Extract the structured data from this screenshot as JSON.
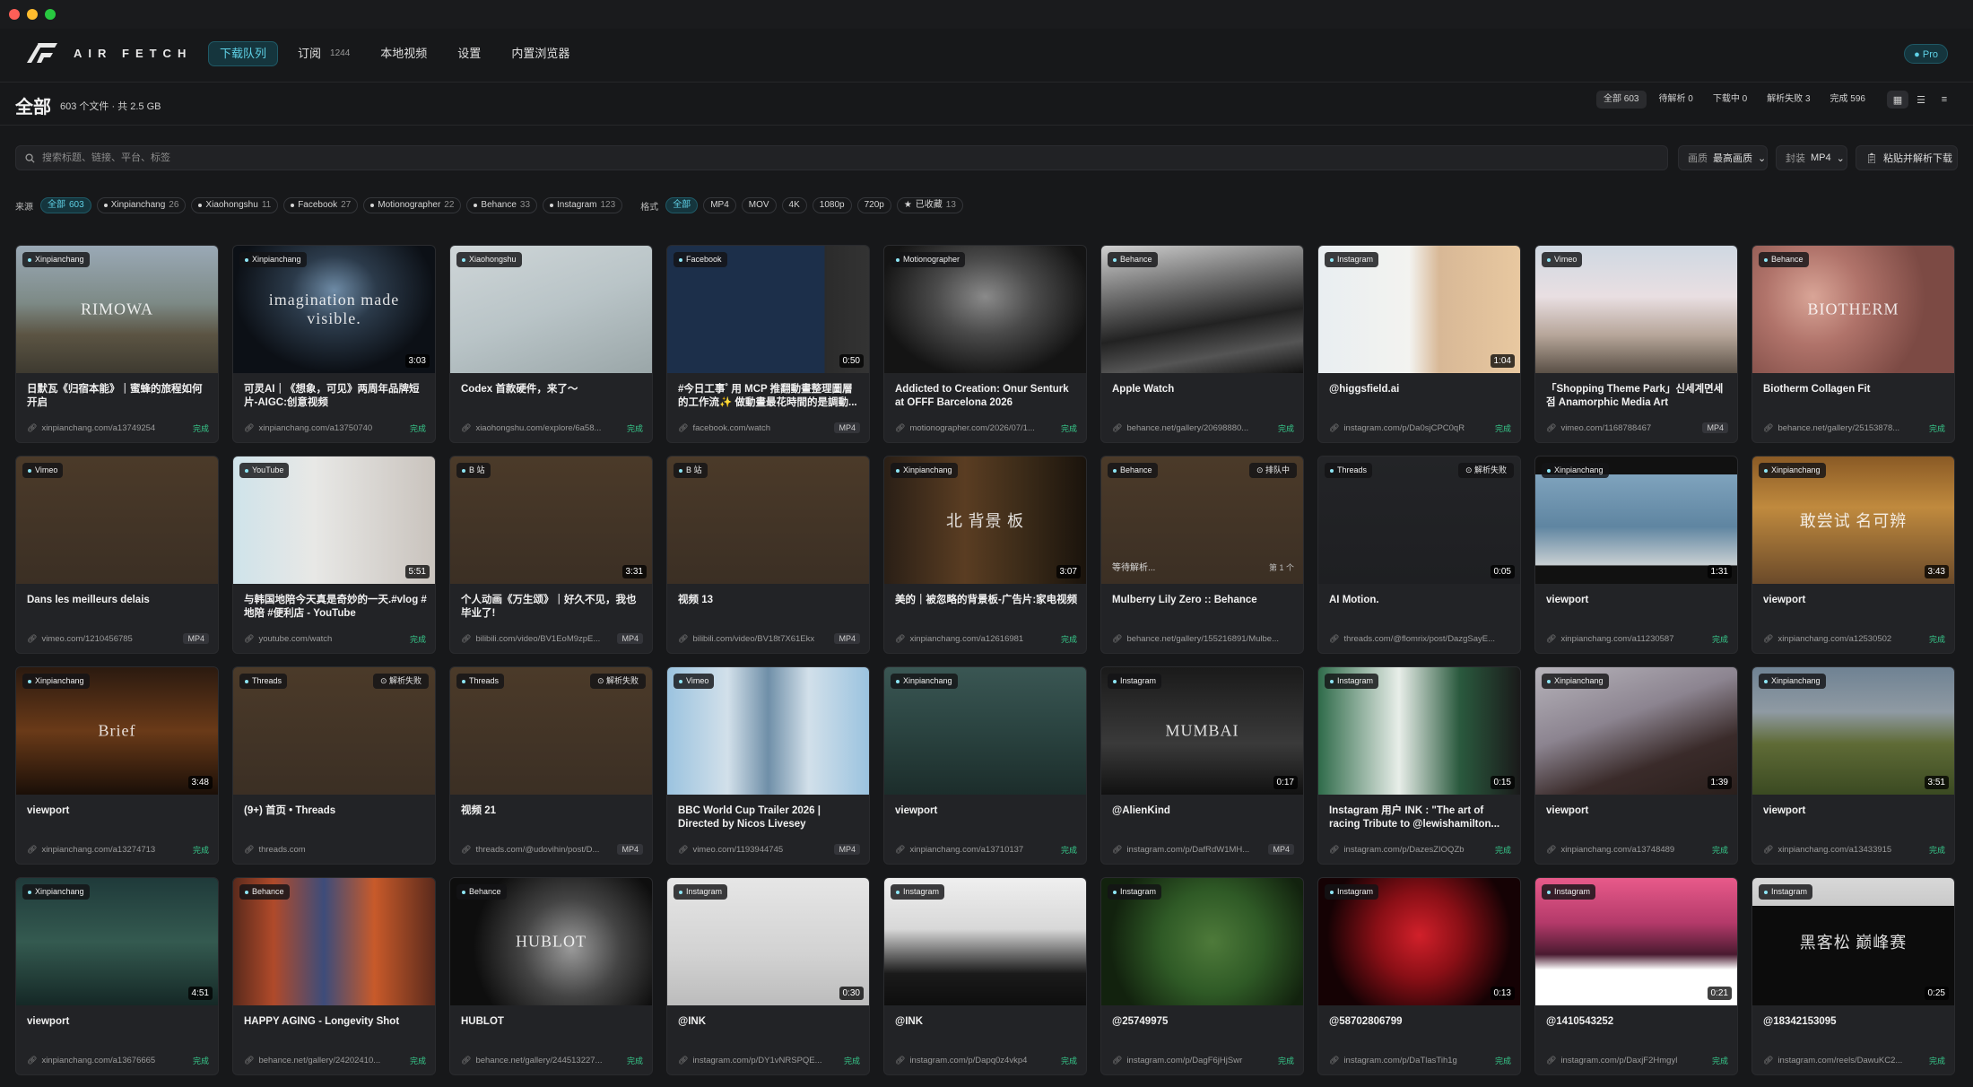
{
  "colors": {
    "accent": "#5fd1e6",
    "done": "#37c98b",
    "bg": "#17181a"
  },
  "app": {
    "brand": "AIR FETCH",
    "pro": "Pro"
  },
  "nav": {
    "tabs": [
      {
        "label": "下载队列",
        "count": ""
      },
      {
        "label": "订阅",
        "count": "1244"
      },
      {
        "label": "本地视频",
        "count": ""
      },
      {
        "label": "设置",
        "count": ""
      },
      {
        "label": "内置浏览器",
        "count": ""
      }
    ]
  },
  "header": {
    "title": "全部",
    "subtitle": "603 个文件 · 共 2.5 GB",
    "stats": [
      "全部 603",
      "待解析 0",
      "下载中 0",
      "解析失败 3",
      "完成 596"
    ]
  },
  "search": {
    "placeholder": "搜索标题、链接、平台、标签"
  },
  "controls": {
    "quality_label": "画质",
    "quality_value": "最高画质",
    "format_label": "封装",
    "format_value": "MP4",
    "paste_button": "粘贴并解析下载"
  },
  "filters": {
    "source_label": "来源",
    "sources": [
      {
        "name": "全部",
        "count": "603"
      },
      {
        "name": "Xinpianchang",
        "count": "26"
      },
      {
        "name": "Xiaohongshu",
        "count": "11"
      },
      {
        "name": "Facebook",
        "count": "27"
      },
      {
        "name": "Motionographer",
        "count": "22"
      },
      {
        "name": "Behance",
        "count": "33"
      },
      {
        "name": "Instagram",
        "count": "123"
      }
    ],
    "format_label": "格式",
    "formats": [
      "全部",
      "MP4",
      "MOV",
      "4K",
      "1080p",
      "720p"
    ],
    "starred": {
      "name": "已收藏",
      "count": "13"
    }
  },
  "cards": [
    {
      "source": "Xinpianchang",
      "title": "日默瓦《归宿本能》｜蜜蜂的旅程如何开启",
      "url": "xinpianchang.com/a13749254",
      "tag": "完成",
      "duration": "",
      "status": "",
      "thumb": "linear-gradient(180deg,#9aa9b6 0%,#7d8a86 45%,#5b5443 70%,#3e3a30 100%)",
      "overlay": "RIMOWA"
    },
    {
      "source": "Xinpianchang",
      "title": "可灵AI｜《想象，可见》两周年品牌短片-AIGC:创意视频",
      "url": "xinpianchang.com/a13750740",
      "tag": "完成",
      "duration": "3:03",
      "status": "",
      "thumb": "radial-gradient(ellipse at 50% 35%,#6e8ba6 0%,#2b3a4a 30%,#0c1016 70%)",
      "overlay": "imagination made visible."
    },
    {
      "source": "Xiaohongshu",
      "title": "Codex 首款硬件，来了～",
      "url": "xiaohongshu.com/explore/6a58...",
      "tag": "完成",
      "duration": "",
      "status": "",
      "thumb": "linear-gradient(160deg,#cfd6d8 0%,#b9c4c7 50%,#9aa6a8 100%)",
      "overlay": ""
    },
    {
      "source": "Facebook",
      "title": "#今日工事˚ 用 MCP 推翻動畫整理圖層的工作流✨ 做動畫最花時間的是調動...",
      "url": "facebook.com/watch",
      "tag": "MP4",
      "duration": "0:50",
      "status": "",
      "thumb": "linear-gradient(90deg,#1c2f4a 0%,#1c2f4a 78%,#2b2b2b 78%,#333 100%)",
      "overlay": ""
    },
    {
      "source": "Motionographer",
      "title": "Addicted to Creation: Onur Senturk at OFFF Barcelona 2026",
      "url": "motionographer.com/2026/07/1...",
      "tag": "完成",
      "duration": "",
      "status": "",
      "thumb": "radial-gradient(ellipse at 50% 40%,#8a8a8a 0%,#4a4a4a 35%,#141414 75%)",
      "overlay": ""
    },
    {
      "source": "Behance",
      "title": "Apple Watch",
      "url": "behance.net/gallery/20698880...",
      "tag": "完成",
      "duration": "",
      "status": "",
      "thumb": "linear-gradient(170deg,#d0d0d0 0%,#777 30%,#222 60%,#555 80%,#111 100%)",
      "overlay": ""
    },
    {
      "source": "Instagram",
      "title": "@higgsfield.ai",
      "url": "instagram.com/p/Da0sjCPC0qR",
      "tag": "完成",
      "duration": "1:04",
      "status": "",
      "thumb": "linear-gradient(90deg,#e9eef1 0%,#f3f3f0 45%,#d8b896 60%,#e8c8a0 100%)",
      "overlay": ""
    },
    {
      "source": "Vimeo",
      "title": "「Shopping Theme Park」신세계면세점 Anamorphic Media Art",
      "url": "vimeo.com/1168788467",
      "tag": "MP4",
      "duration": "",
      "status": "",
      "thumb": "linear-gradient(180deg,#cfd8e2 0%,#e9dfe2 40%,#b7a69a 70%,#5a5046 100%)",
      "overlay": ""
    },
    {
      "source": "Behance",
      "title": "Biotherm Collagen Fit",
      "url": "behance.net/gallery/25153878...",
      "tag": "完成",
      "duration": "",
      "status": "",
      "thumb": "radial-gradient(circle at 30% 40%,#d9a597 0%,#b0736a 30%,#7c4a44 70%)",
      "overlay": "BIOTHERM"
    },
    {
      "source": "Vimeo",
      "title": "Dans les meilleurs delais",
      "url": "vimeo.com/1210456785",
      "tag": "MP4",
      "duration": "",
      "status": "",
      "thumb": "linear-gradient(180deg,#4b3a29 0%,#3b2f24 100%)",
      "overlay": ""
    },
    {
      "source": "YouTube",
      "title": "与韩国地陪今天真是奇妙的一天.#vlog #地陪 #便利店 - YouTube",
      "url": "youtube.com/watch",
      "tag": "完成",
      "duration": "5:51",
      "status": "",
      "thumb": "linear-gradient(90deg,#cfe3ea 0%,#e8e8e6 40%,#c9c3bd 100%)",
      "overlay": ""
    },
    {
      "source": "B 站",
      "title": "个人动画《万生颂》｜好久不见，我也毕业了!",
      "url": "bilibili.com/video/BV1EoM9zpE...",
      "tag": "MP4",
      "duration": "3:31",
      "status": "",
      "thumb": "linear-gradient(180deg,#4b3a29 0%,#3b2f24 100%)",
      "overlay": ""
    },
    {
      "source": "B 站",
      "title": "视频 13",
      "url": "bilibili.com/video/BV18t7X61Ekx",
      "tag": "MP4",
      "duration": "",
      "status": "",
      "thumb": "linear-gradient(180deg,#4b3a29 0%,#3b2f24 100%)",
      "overlay": ""
    },
    {
      "source": "Xinpianchang",
      "title": "美的｜被忽略的背景板-广告片:家电视频",
      "url": "xinpianchang.com/a12616981",
      "tag": "完成",
      "duration": "3:07",
      "status": "",
      "thumb": "linear-gradient(90deg,#2a1f16 0%,#5a3d22 40%,#3a2a18 70%,#1a130c 100%)",
      "overlay": "北 背景 板"
    },
    {
      "source": "Behance",
      "title": "Mulberry Lily Zero :: Behance",
      "url": "behance.net/gallery/155216891/Mulbe...",
      "tag": "",
      "duration": "",
      "status": "排队中",
      "thumb": "linear-gradient(180deg,#4b3a29 0%,#3b2f24 100%)",
      "overlay": "",
      "waiting": "等待解析...",
      "queue": "第 1 个"
    },
    {
      "source": "Threads",
      "title": "AI Motion.",
      "url": "threads.com/@flomrix/post/DazgSayE...",
      "tag": "",
      "duration": "0:05",
      "status": "解析失败",
      "thumb": "linear-gradient(180deg,#232427 0%,#1e1f22 100%)",
      "overlay": ""
    },
    {
      "source": "Xinpianchang",
      "title": "viewport",
      "url": "xinpianchang.com/a11230587",
      "tag": "完成",
      "duration": "1:31",
      "status": "",
      "thumb": "linear-gradient(180deg,#111 0%,#111 14%,#7fa3bd 14%,#5f85a1 55%,#c8cfd2 85%,#111 86%)",
      "overlay": ""
    },
    {
      "source": "Xinpianchang",
      "title": "viewport",
      "url": "xinpianchang.com/a12530502",
      "tag": "完成",
      "duration": "3:43",
      "status": "",
      "thumb": "linear-gradient(180deg,#8a5a25 0%,#c08a3e 40%,#6b4a2a 100%)",
      "overlay": "敢尝试 名可辨"
    },
    {
      "source": "Xinpianchang",
      "title": "viewport",
      "url": "xinpianchang.com/a13274713",
      "tag": "完成",
      "duration": "3:48",
      "status": "",
      "thumb": "linear-gradient(180deg,#2b1a10 0%,#6a3a18 50%,#1a0f08 100%)",
      "overlay": "Brief"
    },
    {
      "source": "Threads",
      "title": "(9+) 首页 • Threads",
      "url": "threads.com",
      "tag": "",
      "duration": "",
      "status": "解析失败",
      "thumb": "linear-gradient(180deg,#4b3a29 0%,#3b2f24 100%)",
      "overlay": ""
    },
    {
      "source": "Threads",
      "title": "视频 21",
      "url": "threads.com/@udovihin/post/D...",
      "tag": "MP4",
      "duration": "",
      "status": "解析失败",
      "thumb": "linear-gradient(180deg,#4b3a29 0%,#3b2f24 100%)",
      "overlay": ""
    },
    {
      "source": "Vimeo",
      "title": "BBC World Cup Trailer 2026 | Directed by Nicos Livesey",
      "url": "vimeo.com/1193944745",
      "tag": "MP4",
      "duration": "",
      "status": "",
      "thumb": "linear-gradient(90deg,#9bc3df 0%,#d2e0ea 30%,#6f8fa8 50%,#d2e0ea 70%,#9bc3df 100%)",
      "overlay": ""
    },
    {
      "source": "Xinpianchang",
      "title": "viewport",
      "url": "xinpianchang.com/a13710137",
      "tag": "完成",
      "duration": "",
      "status": "",
      "thumb": "linear-gradient(180deg,#3a5653 0%,#2a4340 50%,#1c2d2b 100%)",
      "overlay": ""
    },
    {
      "source": "Instagram",
      "title": "@AlienKind",
      "url": "instagram.com/p/DafRdW1MH...",
      "tag": "MP4",
      "duration": "0:17",
      "status": "",
      "thumb": "linear-gradient(180deg,#1a1a1a 0%,#3a3a3a 60%,#111 100%)",
      "overlay": "MUMBAI"
    },
    {
      "source": "Instagram",
      "title": "Instagram 用户 INK : \"The art of racing Tribute to @lewishamilton...",
      "url": "instagram.com/p/DazesZIOQZb",
      "tag": "完成",
      "duration": "0:15",
      "status": "",
      "thumb": "linear-gradient(90deg,#2f6b4a 0%,#e8eee9 40%,#2a5a3e 70%,#1a1a1a 100%)",
      "overlay": ""
    },
    {
      "source": "Xinpianchang",
      "title": "viewport",
      "url": "xinpianchang.com/a13748489",
      "tag": "完成",
      "duration": "1:39",
      "status": "",
      "thumb": "linear-gradient(160deg,#b7b4bb 0%,#8c8490 40%,#3a2b2a 70%,#2a1f1c 100%)",
      "overlay": ""
    },
    {
      "source": "Xinpianchang",
      "title": "viewport",
      "url": "xinpianchang.com/a13433915",
      "tag": "完成",
      "duration": "3:51",
      "status": "",
      "thumb": "linear-gradient(180deg,#6f8293 0%,#8f9aa3 35%,#5f6b36 60%,#3b4a22 100%)",
      "overlay": ""
    },
    {
      "source": "Xinpianchang",
      "title": "viewport",
      "url": "xinpianchang.com/a13676665",
      "tag": "完成",
      "duration": "4:51",
      "status": "",
      "thumb": "linear-gradient(180deg,#1f3a3a 0%,#345a50 50%,#152826 100%)",
      "overlay": ""
    },
    {
      "source": "Behance",
      "title": "HAPPY AGING - Longevity Shot",
      "url": "behance.net/gallery/24202410...",
      "tag": "完成",
      "duration": "",
      "status": "",
      "thumb": "linear-gradient(90deg,#5a2a1c 0%,#b04a2a 20%,#3d4c7a 45%,#c85a2a 70%,#5a2a1c 100%)",
      "overlay": ""
    },
    {
      "source": "Behance",
      "title": "HUBLOT",
      "url": "behance.net/gallery/244513227...",
      "tag": "完成",
      "duration": "",
      "status": "",
      "thumb": "radial-gradient(circle at 60% 55%,#9a9a9a 0%,#444 35%,#0e0e0e 70%)",
      "overlay": "HUBLOT"
    },
    {
      "source": "Instagram",
      "title": "@INK",
      "url": "instagram.com/p/DY1vNRSPQE...",
      "tag": "完成",
      "duration": "0:30",
      "status": "",
      "thumb": "linear-gradient(180deg,#e6e6e6 0%,#d2d2d2 60%,#bcbcbc 100%)",
      "overlay": ""
    },
    {
      "source": "Instagram",
      "title": "@INK",
      "url": "instagram.com/p/Dapq0z4vkp4",
      "tag": "完成",
      "duration": "",
      "status": "",
      "thumb": "linear-gradient(180deg,#efefef 0%,#d8d8d8 40%,#1a1a1a 75%,#0e0e0e 100%)",
      "overlay": ""
    },
    {
      "source": "Instagram",
      "title": "@25749975",
      "url": "instagram.com/p/DagF6jHjSwr",
      "tag": "完成",
      "duration": "",
      "status": "",
      "thumb": "radial-gradient(circle at 55% 50%,#4e7a3a 0%,#2f5a26 40%,#12220e 80%)",
      "overlay": ""
    },
    {
      "source": "Instagram",
      "title": "@58702806799",
      "url": "instagram.com/p/DaTlasTih1g",
      "tag": "完成",
      "duration": "0:13",
      "status": "",
      "thumb": "radial-gradient(circle at 50% 45%,#d1202a 0%,#8a0f16 35%,#150204 75%)",
      "overlay": ""
    },
    {
      "source": "Instagram",
      "title": "@1410543252",
      "url": "instagram.com/p/DaxjF2Hmgyl",
      "tag": "完成",
      "duration": "0:21",
      "status": "",
      "thumb": "linear-gradient(180deg,#e85a8a 0%,#b43a6a 35%,#4a1a30 60%,#ffffff 72%,#ffffff 100%)",
      "overlay": ""
    },
    {
      "source": "Instagram",
      "title": "@18342153095",
      "url": "instagram.com/reels/DawuKC2...",
      "tag": "完成",
      "duration": "0:25",
      "status": "",
      "thumb": "linear-gradient(180deg,#d8d8d8 0%,#c9c9c9 22%,#0c0c0c 22%,#0c0c0c 100%)",
      "overlay": "黑客松 巅峰赛"
    }
  ]
}
